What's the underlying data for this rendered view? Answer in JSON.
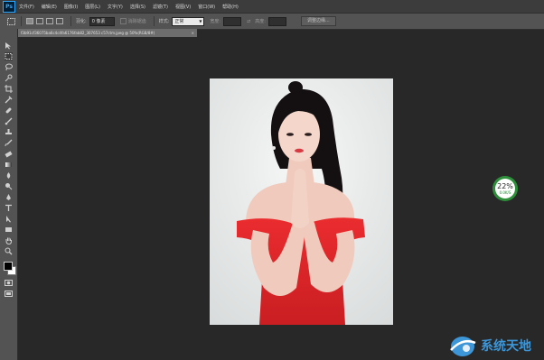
{
  "app": {
    "logo": "Ps"
  },
  "menu": [
    "文件(F)",
    "编辑(E)",
    "图像(I)",
    "图层(L)",
    "文字(Y)",
    "选择(S)",
    "滤镜(T)",
    "视图(V)",
    "窗口(W)",
    "帮助(H)"
  ],
  "options": {
    "feather_label": "羽化:",
    "feather_value": "0 像素",
    "antialias_label": "消除锯齿",
    "style_label": "样式:",
    "style_value": "正常",
    "width_label": "宽度:",
    "height_label": "高度:",
    "refine_button": "调整边缘..."
  },
  "document": {
    "tab_title": "f3b91cf36075ba6c4c4fa6176fab82_307653 c57ctm.jpeg @ 50%(RGB/8#)",
    "close_glyph": "×"
  },
  "perf_widget": {
    "percent": "22%",
    "speed": "0.0K/S"
  },
  "watermark": {
    "text": "系统天地"
  },
  "colors": {
    "accent": "#31a8ff",
    "widget_green": "#2e8f3b",
    "dress_red": "#e0262a",
    "watermark_blue": "#3d96d8"
  }
}
